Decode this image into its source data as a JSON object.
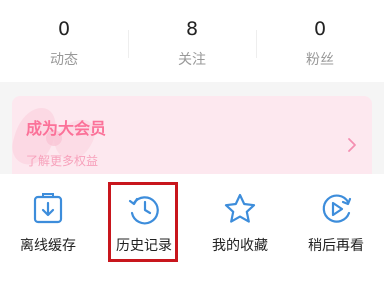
{
  "stats": [
    {
      "value": "0",
      "label": "动态"
    },
    {
      "value": "8",
      "label": "关注"
    },
    {
      "value": "0",
      "label": "粉丝"
    }
  ],
  "vip": {
    "title": "成为大会员",
    "subtitle": "了解更多权益",
    "chevron_icon": "chevron-right-icon"
  },
  "tools": [
    {
      "label": "离线缓存",
      "icon": "download-box-icon"
    },
    {
      "label": "历史记录",
      "icon": "clock-history-icon"
    },
    {
      "label": "我的收藏",
      "icon": "star-icon"
    },
    {
      "label": "稍后再看",
      "icon": "play-later-icon"
    }
  ],
  "colors": {
    "icon_blue": "#3d8ddb",
    "vip_pink": "#fb7299",
    "highlight_red": "#c8161d"
  }
}
